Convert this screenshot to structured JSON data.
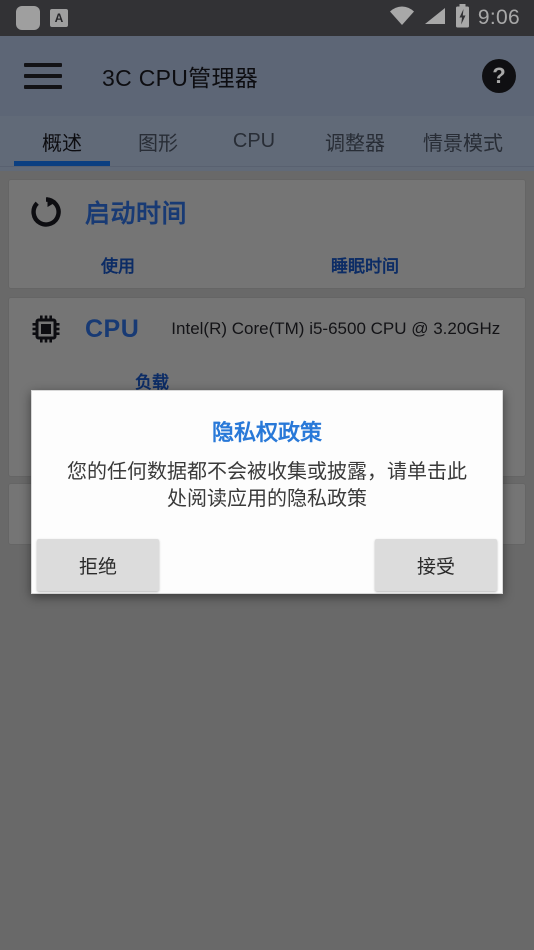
{
  "status_bar": {
    "icons": [
      "rounded-square-icon",
      "keyboard-a-icon",
      "wifi-icon",
      "signal-icon",
      "battery-charging-icon"
    ],
    "keyboard_letter": "A",
    "time": "9:06"
  },
  "app_bar": {
    "menu_icon": "hamburger-menu-icon",
    "title": "3C CPU管理器",
    "help_icon": "help-question-icon",
    "help_label": "?"
  },
  "tabs": {
    "items": [
      {
        "label": "概述",
        "active": true
      },
      {
        "label": "图形",
        "active": false
      },
      {
        "label": "CPU",
        "active": false
      },
      {
        "label": "调整器",
        "active": false
      },
      {
        "label": "情景模式",
        "active": false
      }
    ],
    "active_color": "#1160c4"
  },
  "cards": {
    "uptime": {
      "icon": "refresh-circle-icon",
      "title": "启动时间",
      "sub_labels": [
        "使用",
        "睡眠时间"
      ]
    },
    "cpu": {
      "icon": "cpu-chip-icon",
      "title": "CPU",
      "detail": "Intel(R) Core(TM) i5-6500 CPU @ 3.20GHz",
      "sub_labels": [
        "负载"
      ]
    },
    "third": {
      "icon": "memory-icon"
    }
  },
  "dialog": {
    "title": "隐私权政策",
    "body": "您的任何数据都不会被收集或披露，请单击此处阅读应用的隐私政策",
    "decline_label": "拒绝",
    "accept_label": "接受",
    "title_color": "#2979d8"
  }
}
